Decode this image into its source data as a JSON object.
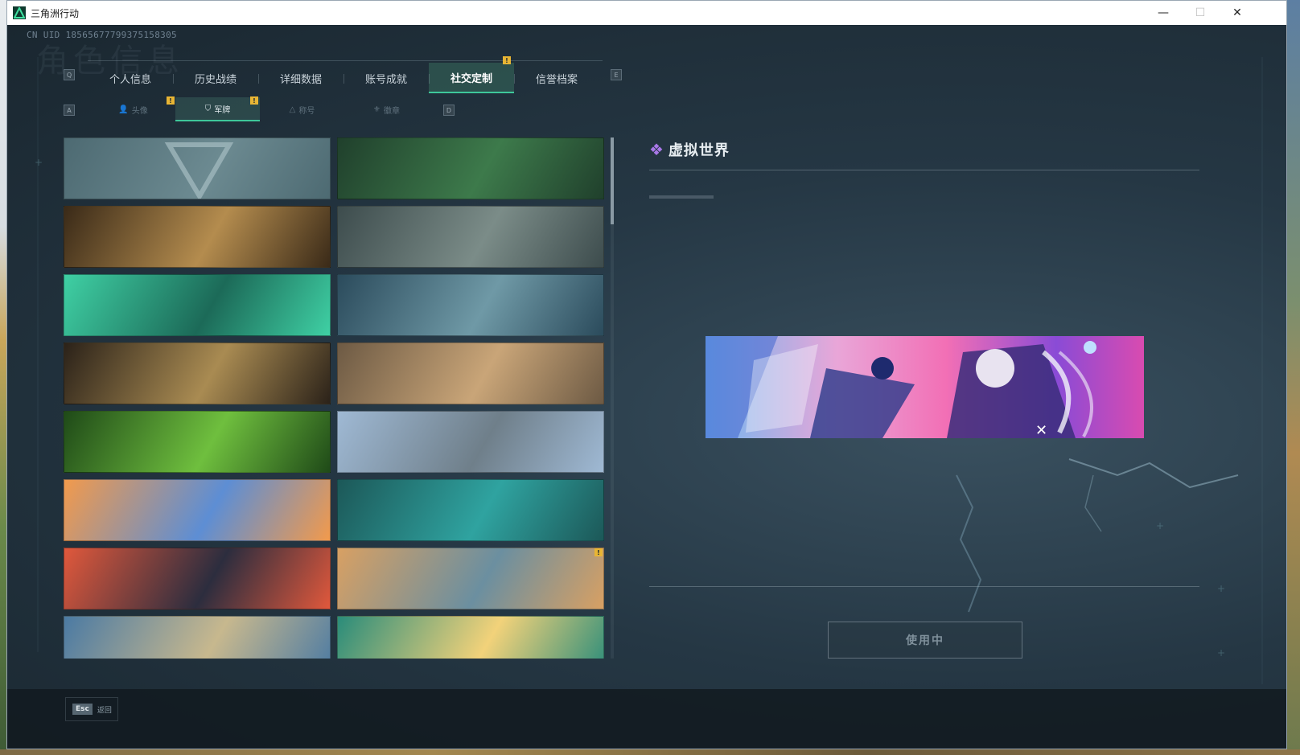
{
  "window": {
    "title": "三角洲行动",
    "controls": {
      "minimize": "—",
      "maximize": "☐",
      "close": "✕"
    }
  },
  "header": {
    "uid": "CN UID 18565677799375158305",
    "watermark": "角色信息"
  },
  "tabs": {
    "prev_key": "Q",
    "next_key": "E",
    "items": [
      {
        "label": "个人信息",
        "active": false
      },
      {
        "label": "历史战绩",
        "active": false
      },
      {
        "label": "详细数据",
        "active": false
      },
      {
        "label": "账号成就",
        "active": false
      },
      {
        "label": "社交定制",
        "active": true,
        "badge": "!"
      },
      {
        "label": "信誉档案",
        "active": false
      }
    ]
  },
  "subtabs": {
    "prev_key": "A",
    "next_key": "D",
    "items": [
      {
        "label": "头像",
        "icon": "person-icon",
        "active": false,
        "badge": "!"
      },
      {
        "label": "军牌",
        "icon": "shield-icon",
        "active": true,
        "badge": "!"
      },
      {
        "label": "称号",
        "icon": "triangle-icon",
        "active": false
      },
      {
        "label": "徽章",
        "icon": "emblem-icon",
        "active": false
      }
    ]
  },
  "cards": [
    {
      "theme": "default-logo",
      "colors": [
        "#4d6a72",
        "#6c8a91"
      ]
    },
    {
      "theme": "weapon-table-green",
      "colors": [
        "#20402c",
        "#3d7a4b"
      ]
    },
    {
      "theme": "soldier-desert",
      "colors": [
        "#3a2a18",
        "#b48c4e"
      ]
    },
    {
      "theme": "sniper-fog",
      "colors": [
        "#3d4c4d",
        "#7b8c88"
      ]
    },
    {
      "theme": "green-cartoon",
      "colors": [
        "#3fd0a4",
        "#1c6a58"
      ]
    },
    {
      "theme": "helicopter-map",
      "colors": [
        "#2b4b5c",
        "#6f99a6"
      ]
    },
    {
      "theme": "weapon-workbench",
      "colors": [
        "#2b2219",
        "#a98b52"
      ]
    },
    {
      "theme": "plane-crash-field",
      "colors": [
        "#6d5a44",
        "#c9a578"
      ]
    },
    {
      "theme": "green-nightvision",
      "colors": [
        "#1f4a18",
        "#6fbf3e"
      ]
    },
    {
      "theme": "rocket-launch",
      "colors": [
        "#9fb9d4",
        "#6f7f8a"
      ]
    },
    {
      "theme": "orange-blue-art",
      "colors": [
        "#f29a4c",
        "#5d8ed4"
      ]
    },
    {
      "theme": "gym-teal",
      "colors": [
        "#1c5858",
        "#2fa3a0"
      ]
    },
    {
      "theme": "sunset-girl",
      "colors": [
        "#e0583c",
        "#2c2d3e"
      ]
    },
    {
      "theme": "beach-pair",
      "colors": [
        "#d8a063",
        "#6b8fa0"
      ],
      "badge": "!"
    },
    {
      "theme": "motorbike-girl",
      "colors": [
        "#4b7aa3",
        "#c7b88e"
      ]
    },
    {
      "theme": "tropical-villa",
      "colors": [
        "#2a8c7a",
        "#f2d27a"
      ]
    }
  ],
  "preview": {
    "name": "虚拟世界",
    "name_icon": "diamond-icon",
    "accent": "#a978e8"
  },
  "actions": {
    "use_button": "使用中"
  },
  "footer": {
    "esc_key": "Esc",
    "esc_label": "返回"
  }
}
